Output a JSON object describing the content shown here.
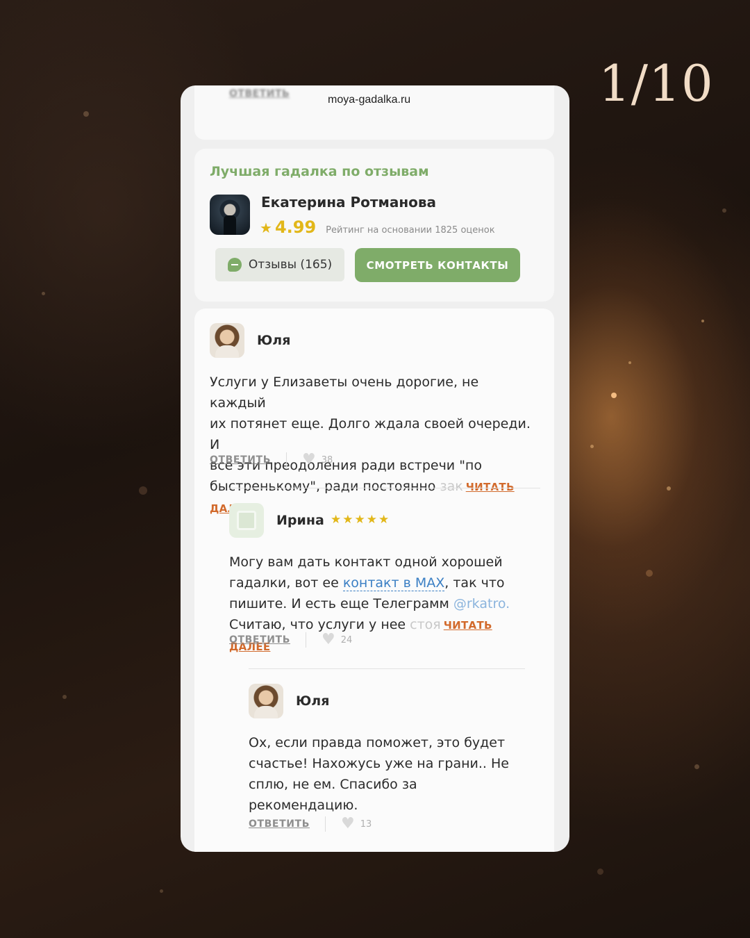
{
  "slide_counter": "1/10",
  "browser": {
    "url": "moya-gadalka.ru"
  },
  "previous_comment": {
    "reply_label": "ОТВЕТИТЬ"
  },
  "best_card": {
    "title": "Лучшая гадалка по отзывам",
    "name": "Екатерина Ротманова",
    "star_icon": "star-icon",
    "rating": "4.99",
    "rating_note": "Рейтинг на основании 1825 оценок",
    "reviews_button": "Отзывы (165)",
    "contacts_button": "СМОТРЕТЬ КОНТАКТЫ"
  },
  "comments": [
    {
      "author": "Юля",
      "text_lines": [
        "Услуги у Елизаветы очень дорогие, не каждый",
        "их потянет еще. Долго ждала своей очереди. И",
        "все эти преодоления ради встречи \"по",
        "быстренькому\", ради постоянно"
      ],
      "text_fade": "зак",
      "read_more": "ЧИТАТЬ ДАЛЕЕ",
      "reply_label": "ОТВЕТИТЬ",
      "likes": "38"
    },
    {
      "author": "Ирина",
      "stars": "★★★★★",
      "rating_stars": 5,
      "text_line1": "Могу вам дать контакт одной хорошей",
      "text_line2_a": "гадалки, вот ее ",
      "link_text": "контакт в MAX",
      "text_line2_b": ", так что",
      "text_line3_a": "пишите. И есть еще Телеграмм ",
      "handle": "@rkatro.",
      "text_line4": "Считаю, что услуги у нее",
      "text_fade": "стоя",
      "read_more": "ЧИТАТЬ ДАЛЕЕ",
      "reply_label": "ОТВЕТИТЬ",
      "likes": "24"
    },
    {
      "author": "Юля",
      "text_lines": [
        "Ох, если правда поможет, это будет",
        "счастье! Нахожусь уже на грани.. Не",
        "сплю, не ем. Спасибо за",
        "рекомендацию."
      ],
      "reply_label": "ОТВЕТИТЬ",
      "likes": "13"
    }
  ],
  "colors": {
    "accent_green": "#7fac69",
    "star_gold": "#e2b719",
    "read_more_orange": "#d26a2c",
    "link_blue": "#3b7fc4"
  }
}
